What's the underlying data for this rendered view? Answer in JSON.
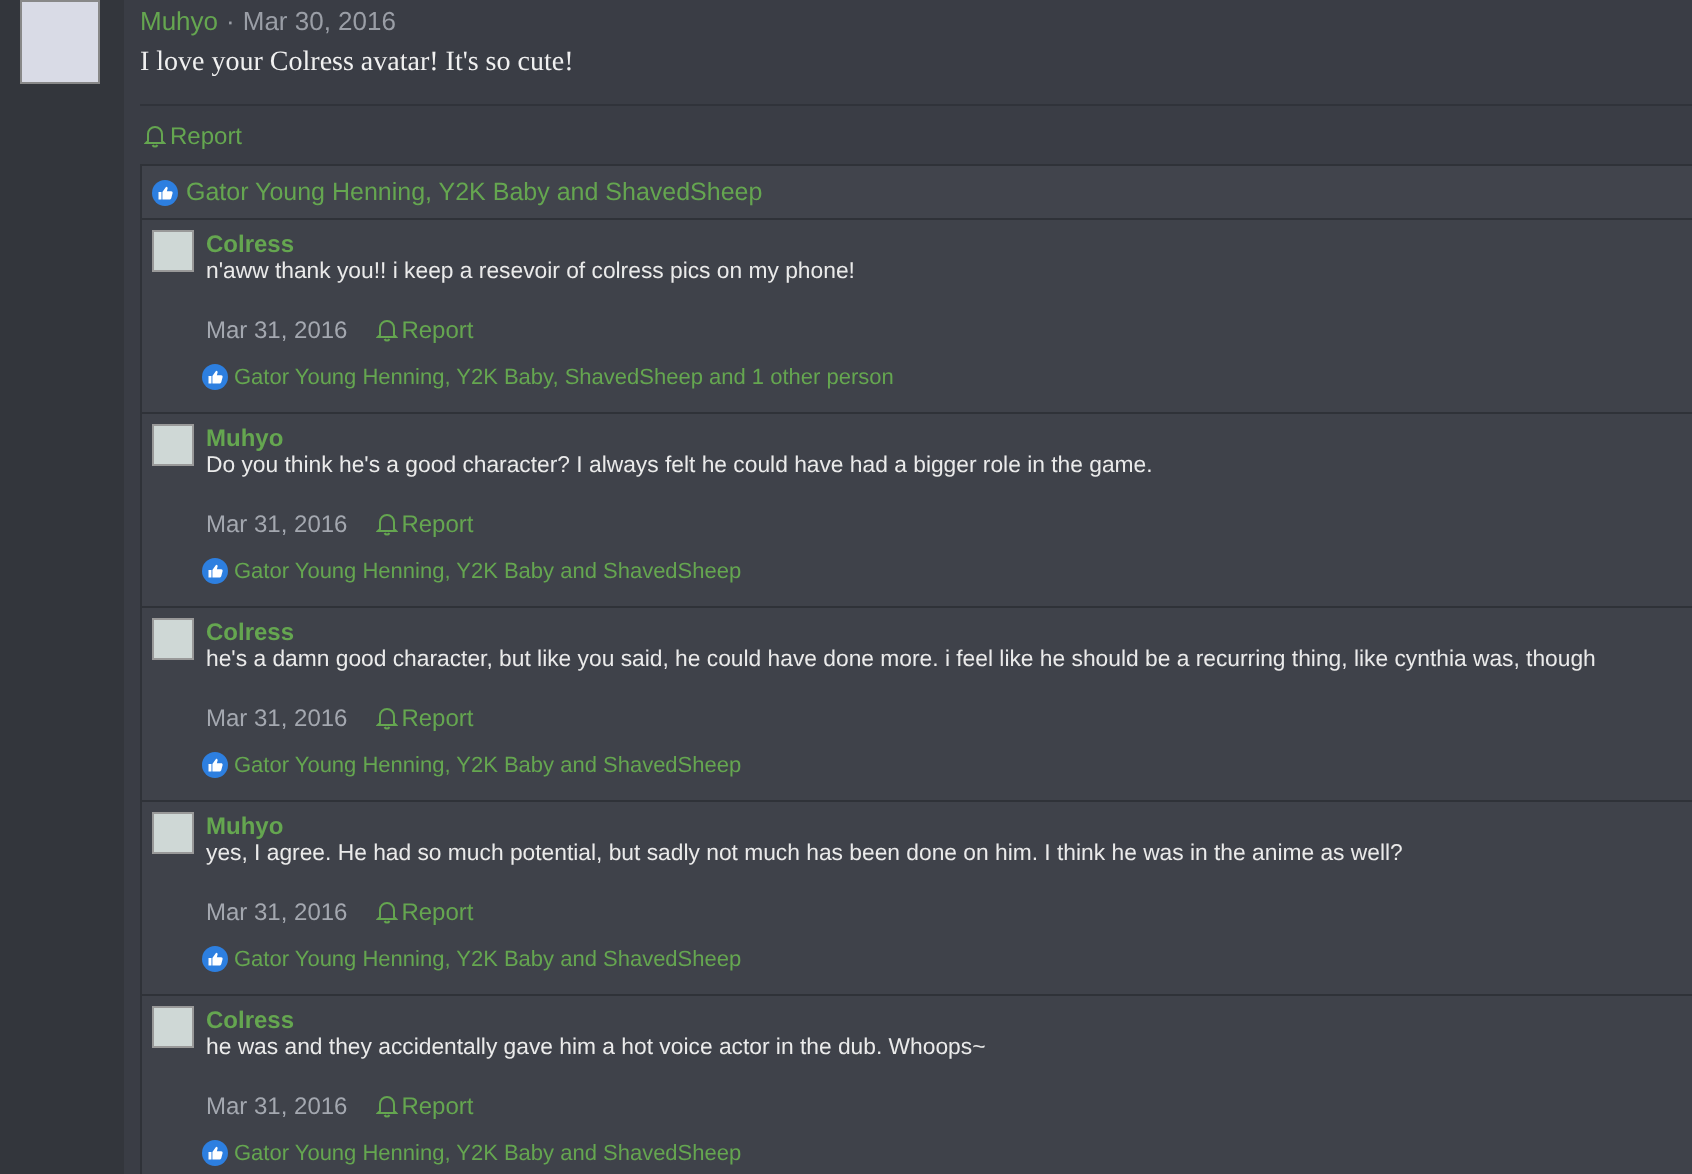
{
  "post": {
    "author": "Muhyo",
    "separator": "·",
    "date": "Mar 30, 2016",
    "body": "I love your Colress avatar! It's so cute!",
    "report": "Report",
    "reactions": "Gator Young Henning, Y2K Baby and ShavedSheep"
  },
  "comments": [
    {
      "author": "Colress",
      "body": "n'aww thank you!! i keep a resevoir of colress pics on my phone!",
      "date": "Mar 31, 2016",
      "report": "Report",
      "reactions": "Gator Young Henning, Y2K Baby, ShavedSheep and 1 other person"
    },
    {
      "author": "Muhyo",
      "body": "Do you think he's a good character? I always felt he could have had a bigger role in the game.",
      "date": "Mar 31, 2016",
      "report": "Report",
      "reactions": "Gator Young Henning, Y2K Baby and ShavedSheep"
    },
    {
      "author": "Colress",
      "body": "he's a damn good character, but like you said, he could have done more. i feel like he should be a recurring thing, like cynthia was, though",
      "date": "Mar 31, 2016",
      "report": "Report",
      "reactions": "Gator Young Henning, Y2K Baby and ShavedSheep"
    },
    {
      "author": "Muhyo",
      "body": "yes, I agree. He had so much potential, but sadly not much has been done on him. I think he was in the anime as well?",
      "date": "Mar 31, 2016",
      "report": "Report",
      "reactions": "Gator Young Henning, Y2K Baby and ShavedSheep"
    },
    {
      "author": "Colress",
      "body": "he was and they accidentally gave him a hot voice actor in the dub. Whoops~",
      "date": "Mar 31, 2016",
      "report": "Report",
      "reactions": "Gator Young Henning, Y2K Baby and ShavedSheep"
    }
  ]
}
